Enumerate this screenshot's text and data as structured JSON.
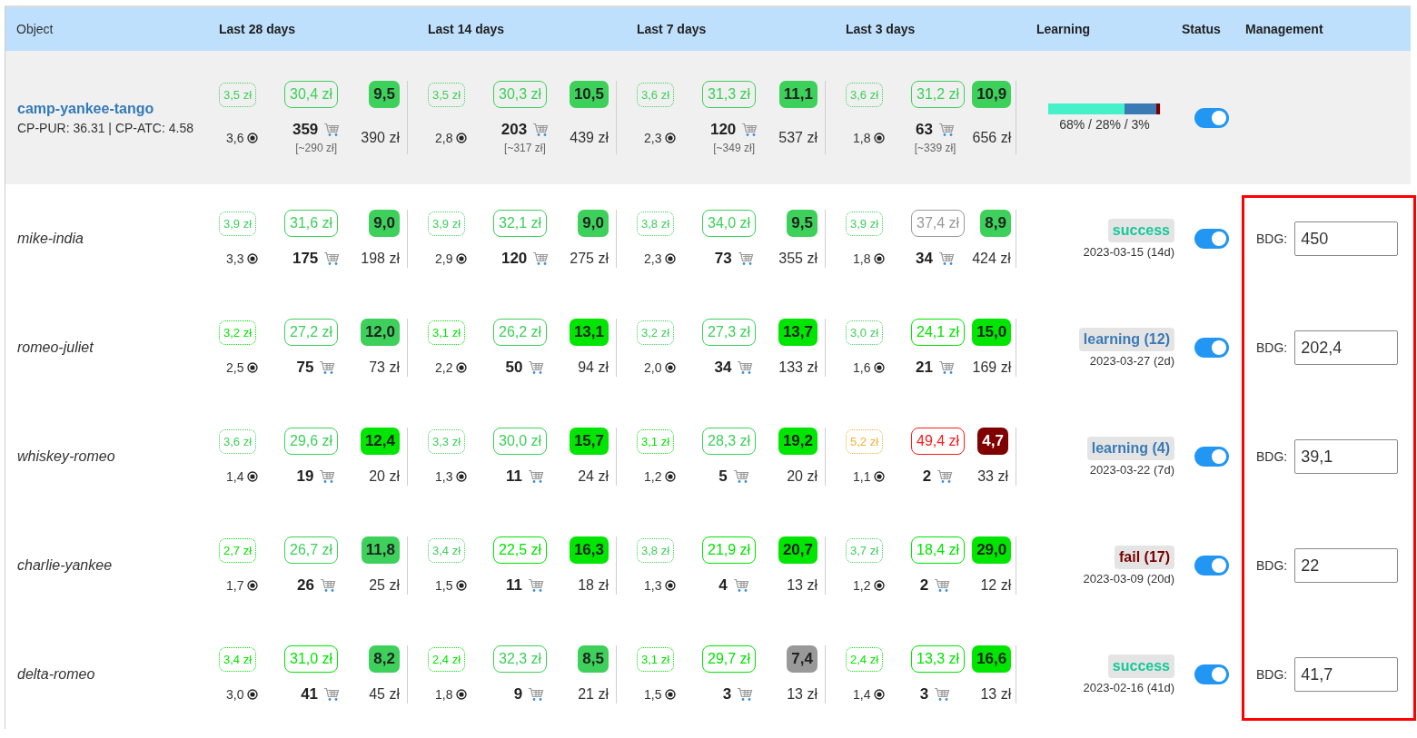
{
  "columns": [
    "Object",
    "Last 28 days",
    "Last 14 days",
    "Last 7 days",
    "Last 3 days",
    "Learning",
    "Status",
    "Management"
  ],
  "summary": {
    "name": "camp-yankee-tango",
    "metrics": "CP-PUR: 36.31 | CP-ATC: 4.58",
    "periods": [
      {
        "cpc": {
          "text": "3,5 zł",
          "color": "#3dd05a"
        },
        "cpa": {
          "text": "30,4 zł",
          "color": "#3dd05a"
        },
        "score": {
          "text": "9,5",
          "color": "#3dd05a"
        },
        "clicks": "3,6",
        "purchases": "359",
        "purchases_value": "[~290 zł]",
        "cost": "390 zł"
      },
      {
        "cpc": {
          "text": "3,5 zł",
          "color": "#3dd05a"
        },
        "cpa": {
          "text": "30,3 zł",
          "color": "#3dd05a"
        },
        "score": {
          "text": "10,5",
          "color": "#3dd05a"
        },
        "clicks": "2,8",
        "purchases": "203",
        "purchases_value": "[~317 zł]",
        "cost": "439 zł"
      },
      {
        "cpc": {
          "text": "3,6 zł",
          "color": "#3dd05a"
        },
        "cpa": {
          "text": "31,3 zł",
          "color": "#3dd05a"
        },
        "score": {
          "text": "11,1",
          "color": "#3dd05a"
        },
        "clicks": "2,3",
        "purchases": "120",
        "purchases_value": "[~349 zł]",
        "cost": "537 zł"
      },
      {
        "cpc": {
          "text": "3,6 zł",
          "color": "#3dd05a"
        },
        "cpa": {
          "text": "31,2 zł",
          "color": "#3dd05a"
        },
        "score": {
          "text": "10,9",
          "color": "#3dd05a"
        },
        "clicks": "1,8",
        "purchases": "63",
        "purchases_value": "[~339 zł]",
        "cost": "656 zł"
      }
    ],
    "learning": {
      "segments": [
        {
          "level": 0.68,
          "color": "#46f0c8"
        },
        {
          "level": 0.28,
          "color": "#3a7ab5"
        },
        {
          "level": 0.03,
          "color": "#7a0000"
        }
      ],
      "text": "68% / 28% / 3%"
    },
    "on": true
  },
  "rows": [
    {
      "name": "mike-india",
      "periods": [
        {
          "cpc": {
            "text": "3,9 zł",
            "color": "#3dd05a"
          },
          "cpa": {
            "text": "31,6 zł",
            "color": "#3dd05a"
          },
          "score": {
            "text": "9,0",
            "color": "#3dd05a"
          },
          "clicks": "3,3",
          "purchases": "175",
          "cost": "198 zł"
        },
        {
          "cpc": {
            "text": "3,9 zł",
            "color": "#3dd05a"
          },
          "cpa": {
            "text": "32,1 zł",
            "color": "#3dd05a"
          },
          "score": {
            "text": "9,0",
            "color": "#3dd05a"
          },
          "clicks": "2,9",
          "purchases": "120",
          "cost": "275 zł"
        },
        {
          "cpc": {
            "text": "3,8 zł",
            "color": "#3dd05a"
          },
          "cpa": {
            "text": "34,0 zł",
            "color": "#3dd05a"
          },
          "score": {
            "text": "9,5",
            "color": "#3dd05a"
          },
          "clicks": "2,3",
          "purchases": "73",
          "cost": "355 zł"
        },
        {
          "cpc": {
            "text": "3,9 zł",
            "color": "#3dd05a"
          },
          "cpa": {
            "text": "37,4 zł",
            "color": "#999999"
          },
          "score": {
            "text": "8,9",
            "color": "#3dd05a"
          },
          "clicks": "1,8",
          "purchases": "34",
          "cost": "424 zł"
        }
      ],
      "learning": {
        "status": "success",
        "color": "#17c99a",
        "date": "2023-03-15 (14d)"
      },
      "on": true,
      "budget": {
        "label": "BDG:",
        "value": "450"
      }
    },
    {
      "name": "romeo-juliet",
      "periods": [
        {
          "cpc": {
            "text": "3,2 zł",
            "color": "#00e600"
          },
          "cpa": {
            "text": "27,2 zł",
            "color": "#3dd05a"
          },
          "score": {
            "text": "12,0",
            "color": "#3dd05a"
          },
          "clicks": "2,5",
          "purchases": "75",
          "cost": "73 zł"
        },
        {
          "cpc": {
            "text": "3,1 zł",
            "color": "#00e600"
          },
          "cpa": {
            "text": "26,2 zł",
            "color": "#3dd05a"
          },
          "score": {
            "text": "13,1",
            "color": "#00e600"
          },
          "clicks": "2,2",
          "purchases": "50",
          "cost": "94 zł"
        },
        {
          "cpc": {
            "text": "3,2 zł",
            "color": "#3dd05a"
          },
          "cpa": {
            "text": "27,3 zł",
            "color": "#3dd05a"
          },
          "score": {
            "text": "13,7",
            "color": "#00e600"
          },
          "clicks": "2,0",
          "purchases": "34",
          "cost": "133 zł"
        },
        {
          "cpc": {
            "text": "3,0 zł",
            "color": "#3dd05a"
          },
          "cpa": {
            "text": "24,1 zł",
            "color": "#00e600"
          },
          "score": {
            "text": "15,0",
            "color": "#00e600"
          },
          "clicks": "1,6",
          "purchases": "21",
          "cost": "169 zł"
        }
      ],
      "learning": {
        "status": "learning (12)",
        "color": "#3a7ab5",
        "date": "2023-03-27 (2d)"
      },
      "on": true,
      "budget": {
        "label": "BDG:",
        "value": "202,4"
      }
    },
    {
      "name": "whiskey-romeo",
      "periods": [
        {
          "cpc": {
            "text": "3,6 zł",
            "color": "#3dd05a"
          },
          "cpa": {
            "text": "29,6 zł",
            "color": "#3dd05a"
          },
          "score": {
            "text": "12,4",
            "color": "#00e600"
          },
          "clicks": "1,4",
          "purchases": "19",
          "cost": "20 zł"
        },
        {
          "cpc": {
            "text": "3,3 zł",
            "color": "#3dd05a"
          },
          "cpa": {
            "text": "30,0 zł",
            "color": "#3dd05a"
          },
          "score": {
            "text": "15,7",
            "color": "#00e600"
          },
          "clicks": "1,3",
          "purchases": "11",
          "cost": "24 zł"
        },
        {
          "cpc": {
            "text": "3,1 zł",
            "color": "#00e600"
          },
          "cpa": {
            "text": "28,3 zł",
            "color": "#3dd05a"
          },
          "score": {
            "text": "19,2",
            "color": "#00e600"
          },
          "clicks": "1,2",
          "purchases": "5",
          "cost": "20 zł"
        },
        {
          "cpc": {
            "text": "5,2 zł",
            "color": "#f5b133"
          },
          "cpa": {
            "text": "49,4 zł",
            "color": "#ff1a1a"
          },
          "score": {
            "text": "4,7",
            "color": "#800000"
          },
          "clicks": "1,1",
          "purchases": "2",
          "cost": "33 zł"
        }
      ],
      "learning": {
        "status": "learning (4)",
        "color": "#3a7ab5",
        "date": "2023-03-22 (7d)"
      },
      "on": true,
      "budget": {
        "label": "BDG:",
        "value": "39,1"
      }
    },
    {
      "name": "charlie-yankee",
      "periods": [
        {
          "cpc": {
            "text": "2,7 zł",
            "color": "#00e600"
          },
          "cpa": {
            "text": "26,7 zł",
            "color": "#3dd05a"
          },
          "score": {
            "text": "11,8",
            "color": "#3dd05a"
          },
          "clicks": "1,7",
          "purchases": "26",
          "cost": "25 zł"
        },
        {
          "cpc": {
            "text": "3,4 zł",
            "color": "#3dd05a"
          },
          "cpa": {
            "text": "22,5 zł",
            "color": "#00e600"
          },
          "score": {
            "text": "16,3",
            "color": "#00e600"
          },
          "clicks": "1,5",
          "purchases": "11",
          "cost": "18 zł"
        },
        {
          "cpc": {
            "text": "3,8 zł",
            "color": "#3dd05a"
          },
          "cpa": {
            "text": "21,9 zł",
            "color": "#00e600"
          },
          "score": {
            "text": "20,7",
            "color": "#00e600"
          },
          "clicks": "1,3",
          "purchases": "4",
          "cost": "13 zł"
        },
        {
          "cpc": {
            "text": "3,7 zł",
            "color": "#3dd05a"
          },
          "cpa": {
            "text": "18,4 zł",
            "color": "#00e600"
          },
          "score": {
            "text": "29,0",
            "color": "#00e600"
          },
          "clicks": "1,2",
          "purchases": "2",
          "cost": "12 zł"
        }
      ],
      "learning": {
        "status": "fail (17)",
        "color": "#7a0000",
        "date": "2023-03-09 (20d)"
      },
      "on": true,
      "budget": {
        "label": "BDG:",
        "value": "22"
      }
    },
    {
      "name": "delta-romeo",
      "periods": [
        {
          "cpc": {
            "text": "3,4 zł",
            "color": "#00e600"
          },
          "cpa": {
            "text": "31,0 zł",
            "color": "#00e600"
          },
          "score": {
            "text": "8,2",
            "color": "#3dd05a"
          },
          "clicks": "3,0",
          "purchases": "41",
          "cost": "45 zł"
        },
        {
          "cpc": {
            "text": "2,4 zł",
            "color": "#00e600"
          },
          "cpa": {
            "text": "32,3 zł",
            "color": "#3dd05a"
          },
          "score": {
            "text": "8,5",
            "color": "#3dd05a"
          },
          "clicks": "1,8",
          "purchases": "9",
          "cost": "21 zł"
        },
        {
          "cpc": {
            "text": "3,1 zł",
            "color": "#00e600"
          },
          "cpa": {
            "text": "29,7 zł",
            "color": "#00e600"
          },
          "score": {
            "text": "7,4",
            "color": "#999999"
          },
          "clicks": "1,5",
          "purchases": "3",
          "cost": "13 zł"
        },
        {
          "cpc": {
            "text": "2,4 zł",
            "color": "#00e600"
          },
          "cpa": {
            "text": "13,3 zł",
            "color": "#00e600"
          },
          "score": {
            "text": "16,6",
            "color": "#00e600"
          },
          "clicks": "1,4",
          "purchases": "3",
          "cost": "13 zł"
        }
      ],
      "learning": {
        "status": "success",
        "color": "#17c99a",
        "date": "2023-02-16 (41d)"
      },
      "on": true,
      "budget": {
        "label": "BDG:",
        "value": "41,7"
      }
    }
  ],
  "management_highlight": true
}
